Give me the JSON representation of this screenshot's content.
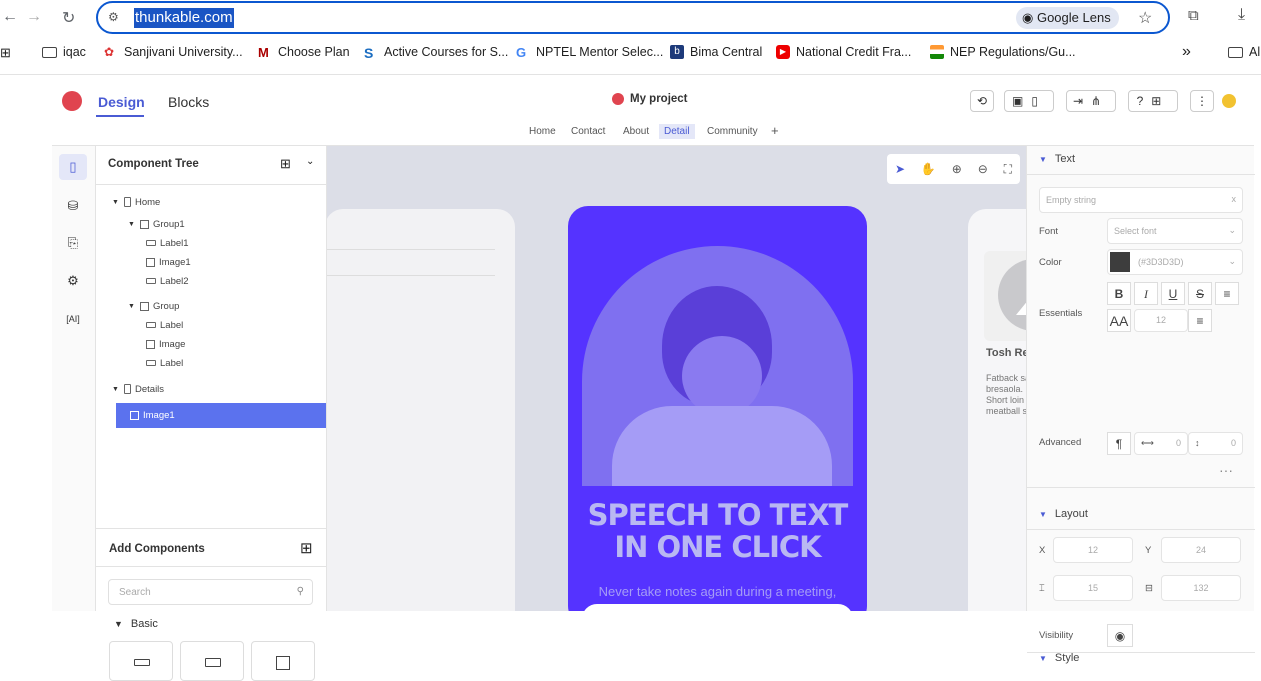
{
  "browser": {
    "url": "thunkable.com",
    "lens_label": "Google Lens",
    "bookmarks": [
      {
        "label": "iqac"
      },
      {
        "label": "Sanjivani University..."
      },
      {
        "label": "Choose Plan"
      },
      {
        "label": "Active Courses for S..."
      },
      {
        "label": "NPTEL Mentor Selec..."
      },
      {
        "label": "Bima Central"
      },
      {
        "label": "National Credit Fra..."
      },
      {
        "label": "NEP Regulations/Gu..."
      }
    ],
    "overflow": "»",
    "last_folder": "Al"
  },
  "app": {
    "tabs": {
      "design": "Design",
      "blocks": "Blocks"
    },
    "project_name": "My project",
    "screens": [
      "Home",
      "Contact",
      "About",
      "Detail",
      "Community"
    ],
    "add_screen": "+",
    "accent": "#4a5bd4"
  },
  "tree": {
    "title": "Component Tree",
    "rows": [
      {
        "label": "Home"
      },
      {
        "label": "Group1"
      },
      {
        "label": "Label1"
      },
      {
        "label": "Image1"
      },
      {
        "label": "Label2"
      },
      {
        "label": "Group"
      },
      {
        "label": "Label"
      },
      {
        "label": "Image"
      },
      {
        "label": "Label"
      },
      {
        "label": "Details"
      },
      {
        "label": "Image1"
      }
    ],
    "add_components": "Add Components",
    "search_placeholder": "Search",
    "basic": "Basic"
  },
  "canvas": {
    "headline_line1": "SPEECH TO TEXT",
    "headline_line2": "IN ONE CLICK",
    "subline": "Never take notes again during a meeting,",
    "card_name": "Tosh Reg",
    "card_text": [
      "Fatback salami chick",
      "bresaola. Boudin ver",
      "Short loin buffalo po",
      "meatball shoulder ar"
    ]
  },
  "props": {
    "text_section": "Text",
    "text_placeholder": "Empty string",
    "font_label": "Font",
    "font_placeholder": "Select font",
    "color_label": "Color",
    "color_value": "(#3D3D3D)",
    "essentials_label": "Essentials",
    "font_size": "12",
    "advanced_label": "Advanced",
    "adv_values": [
      "0",
      "0"
    ],
    "layout_section": "Layout",
    "x_label": "X",
    "x_value": "12",
    "y_label": "Y",
    "y_value": "24",
    "h_value": "15",
    "w_value": "132",
    "visibility_label": "Visibility",
    "style_section": "Style"
  }
}
